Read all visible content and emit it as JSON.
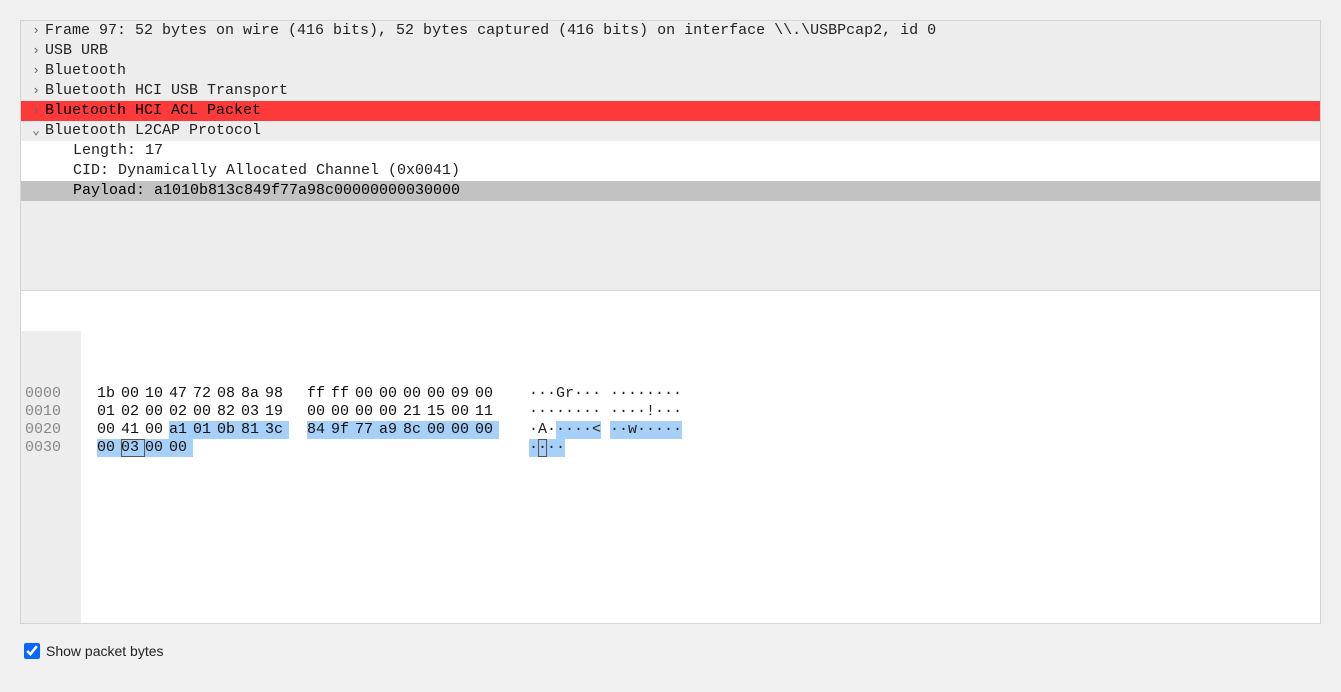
{
  "details": {
    "rows": [
      {
        "expander": "closed",
        "text": "Frame 97: 52 bytes on wire (416 bits), 52 bytes captured (416 bits) on interface \\\\.\\USBPcap2, id 0",
        "highlight": "none",
        "indent": 0
      },
      {
        "expander": "closed",
        "text": "USB URB",
        "highlight": "none",
        "indent": 0
      },
      {
        "expander": "closed",
        "text": "Bluetooth",
        "highlight": "none",
        "indent": 0
      },
      {
        "expander": "closed",
        "text": "Bluetooth HCI USB Transport",
        "highlight": "none",
        "indent": 0
      },
      {
        "expander": "closed",
        "text": "Bluetooth HCI ACL Packet",
        "highlight": "red",
        "indent": 0
      },
      {
        "expander": "open",
        "text": "Bluetooth L2CAP Protocol",
        "highlight": "none",
        "indent": 0
      },
      {
        "expander": "none",
        "text": "Length: 17",
        "highlight": "none",
        "indent": 1
      },
      {
        "expander": "none",
        "text": "CID: Dynamically Allocated Channel (0x0041)",
        "highlight": "none",
        "indent": 1
      },
      {
        "expander": "none",
        "text": "Payload: a1010b813c849f77a98c00000000030000",
        "highlight": "gray",
        "indent": 1
      }
    ]
  },
  "hex": {
    "lines": [
      {
        "offset": "0000",
        "bytes": [
          "1b",
          "00",
          "10",
          "47",
          "72",
          "08",
          "8a",
          "98",
          "ff",
          "ff",
          "00",
          "00",
          "00",
          "00",
          "09",
          "00"
        ],
        "sel": [
          false,
          false,
          false,
          false,
          false,
          false,
          false,
          false,
          false,
          false,
          false,
          false,
          false,
          false,
          false,
          false
        ],
        "ascii": [
          "·",
          "·",
          "·",
          "G",
          "r",
          "·",
          "·",
          "·",
          "·",
          "·",
          "·",
          "·",
          "·",
          "·",
          "·",
          "·"
        ],
        "ascii_sel": [
          false,
          false,
          false,
          false,
          false,
          false,
          false,
          false,
          false,
          false,
          false,
          false,
          false,
          false,
          false,
          false
        ]
      },
      {
        "offset": "0010",
        "bytes": [
          "01",
          "02",
          "00",
          "02",
          "00",
          "82",
          "03",
          "19",
          "00",
          "00",
          "00",
          "00",
          "21",
          "15",
          "00",
          "11"
        ],
        "sel": [
          false,
          false,
          false,
          false,
          false,
          false,
          false,
          false,
          false,
          false,
          false,
          false,
          false,
          false,
          false,
          false
        ],
        "ascii": [
          "·",
          "·",
          "·",
          "·",
          "·",
          "·",
          "·",
          "·",
          "·",
          "·",
          "·",
          "·",
          "!",
          "·",
          "·",
          "·"
        ],
        "ascii_sel": [
          false,
          false,
          false,
          false,
          false,
          false,
          false,
          false,
          false,
          false,
          false,
          false,
          false,
          false,
          false,
          false
        ]
      },
      {
        "offset": "0020",
        "bytes": [
          "00",
          "41",
          "00",
          "a1",
          "01",
          "0b",
          "81",
          "3c",
          "84",
          "9f",
          "77",
          "a9",
          "8c",
          "00",
          "00",
          "00"
        ],
        "sel": [
          false,
          false,
          false,
          true,
          true,
          true,
          true,
          true,
          true,
          true,
          true,
          true,
          true,
          true,
          true,
          true
        ],
        "ascii": [
          "·",
          "A",
          "·",
          "·",
          "·",
          "·",
          "·",
          "<",
          "·",
          "·",
          "w",
          "·",
          "·",
          "·",
          "·",
          "·"
        ],
        "ascii_sel": [
          false,
          false,
          false,
          true,
          true,
          true,
          true,
          true,
          true,
          true,
          true,
          true,
          true,
          true,
          true,
          true
        ]
      },
      {
        "offset": "0030",
        "bytes": [
          "00",
          "03",
          "00",
          "00"
        ],
        "sel": [
          true,
          true,
          true,
          true
        ],
        "boxed": [
          false,
          true,
          false,
          false
        ],
        "ascii": [
          "·",
          "·",
          "·",
          "·"
        ],
        "ascii_sel": [
          true,
          true,
          true,
          true
        ],
        "ascii_boxed": [
          false,
          true,
          false,
          false
        ]
      }
    ]
  },
  "footer": {
    "show_packet_bytes_label": "Show packet bytes",
    "show_packet_bytes_checked": true
  }
}
